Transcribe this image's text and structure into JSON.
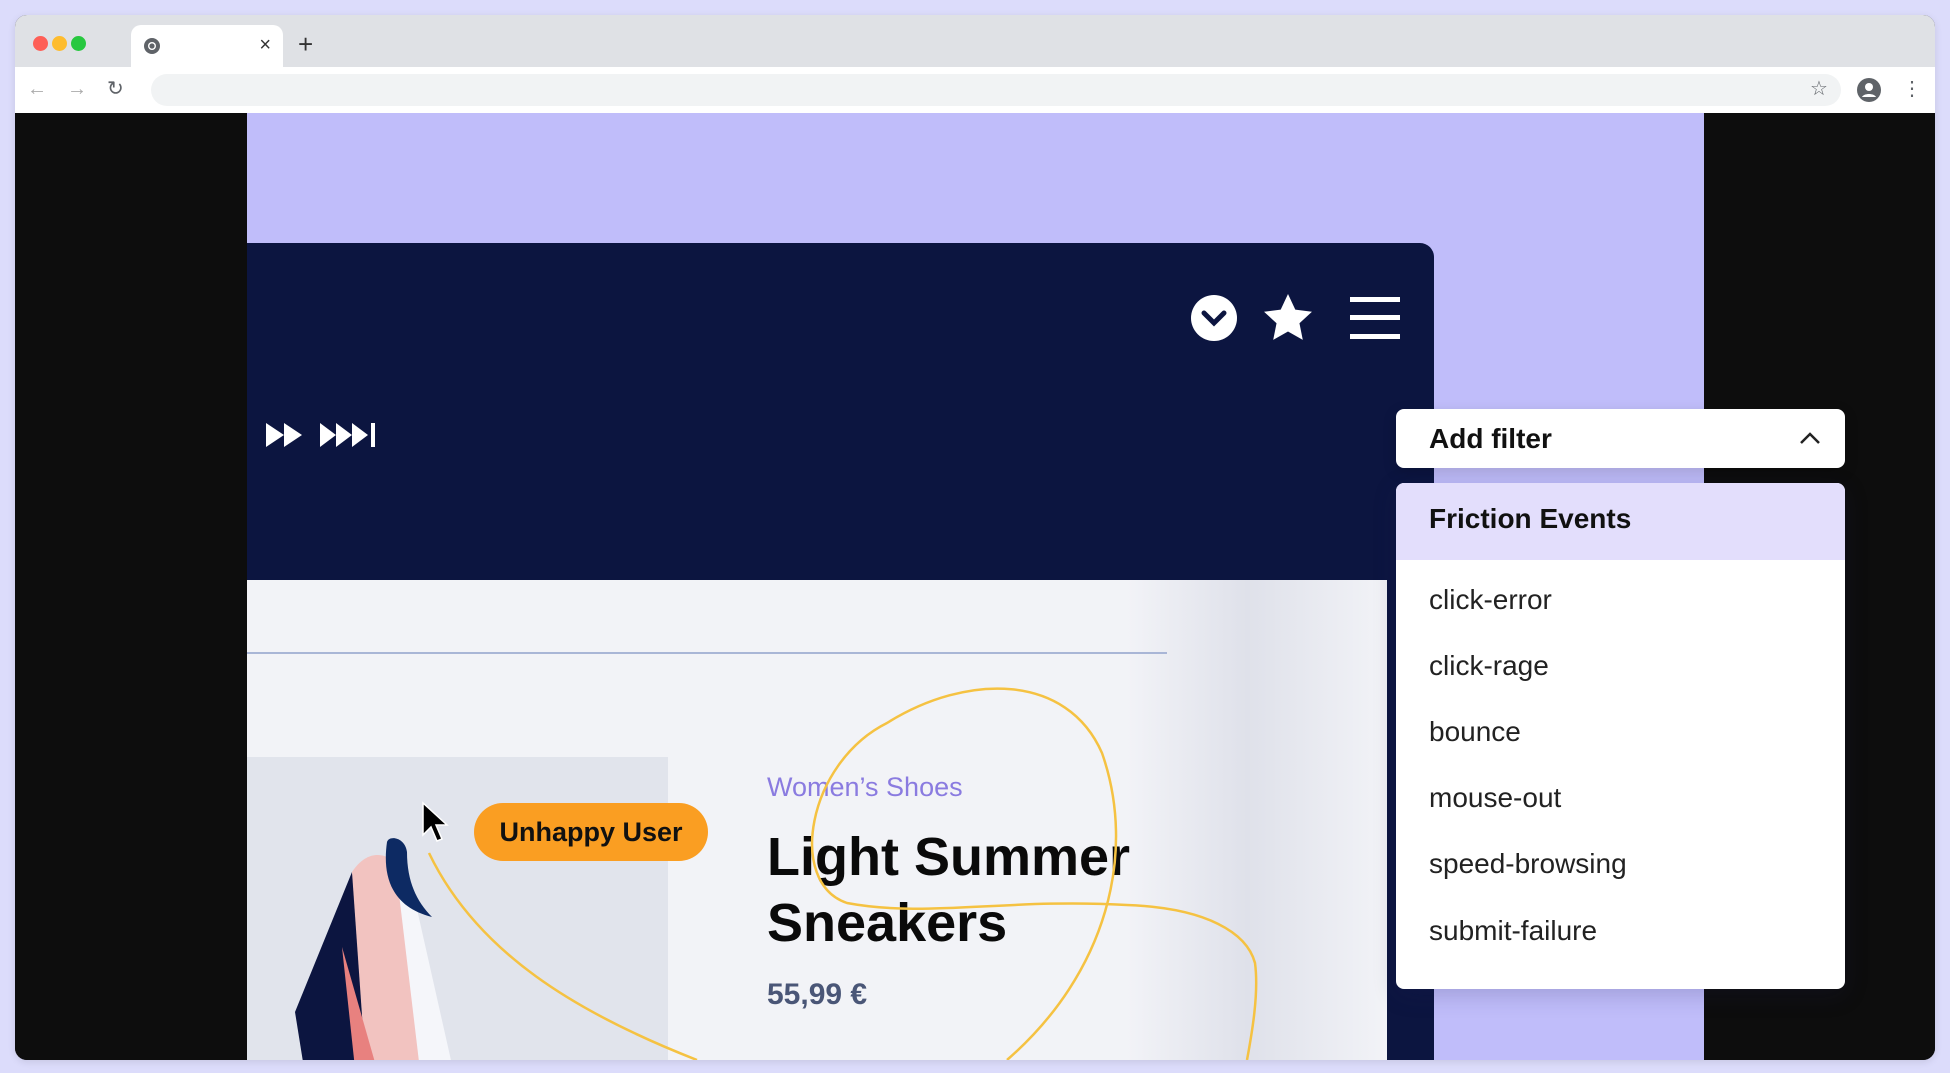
{
  "browser": {
    "tab_title": "",
    "tab_close": "×",
    "new_tab": "+",
    "address": ""
  },
  "player": {
    "icons": [
      "chevron-down-circle-icon",
      "star-icon",
      "hamburger-menu-icon",
      "fast-forward-icon",
      "skip-forward-icon"
    ]
  },
  "filter": {
    "label": "Add filter",
    "dropdown": {
      "header": "Friction Events",
      "items": [
        "click-error",
        "click-rage",
        "bounce",
        "mouse-out",
        "speed-browsing",
        "submit-failure"
      ]
    }
  },
  "product": {
    "category": "Women’s Shoes",
    "title_line1": "Light Summer",
    "title_line2": "Sneakers",
    "price": "55,99 €"
  },
  "badge": {
    "label": "Unhappy User"
  },
  "colors": {
    "navy": "#0c1540",
    "accent_purple": "#c0bdfa",
    "badge_orange": "#fa9e22",
    "highlight": "#e3defc",
    "curve": "#f5c242"
  }
}
